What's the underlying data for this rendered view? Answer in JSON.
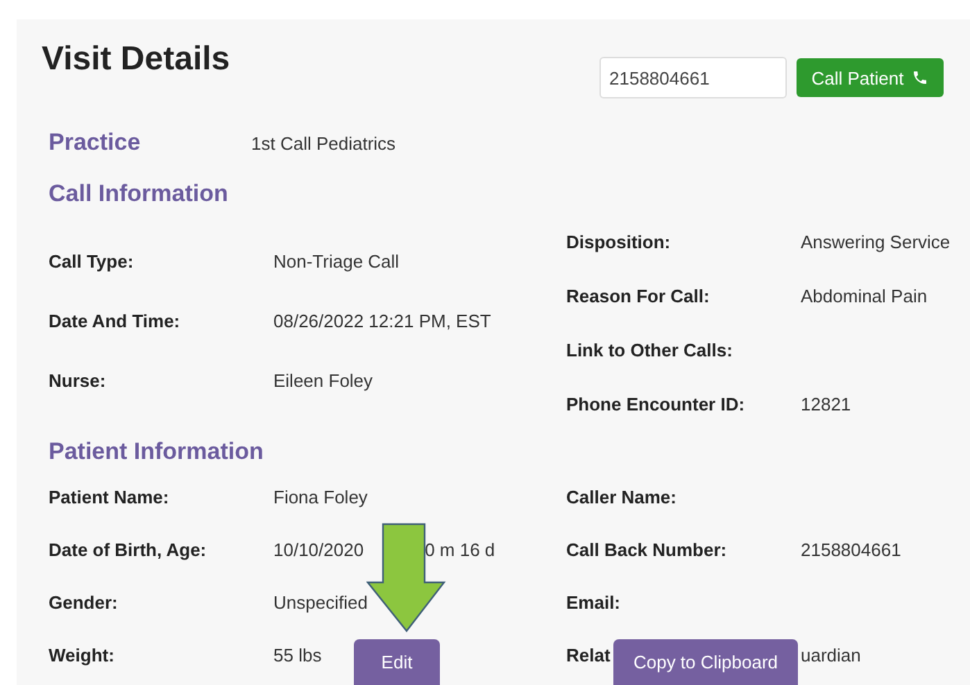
{
  "title": "Visit Details",
  "phone_field": {
    "value": "2158804661"
  },
  "call_button": {
    "label": "Call Patient"
  },
  "practice": {
    "label": "Practice",
    "value": "1st Call Pediatrics"
  },
  "call_information": {
    "heading": "Call Information",
    "left": [
      {
        "label": "Call Type:",
        "values": [
          "Non-Triage Call"
        ]
      },
      {
        "label": "Date And Time:",
        "values": [
          "08/26/2022 12:21 PM, EST"
        ]
      },
      {
        "label": "Nurse:",
        "values": [
          "Eileen Foley"
        ]
      }
    ],
    "right": [
      {
        "label": "Disposition:",
        "values": [
          "Answering Service"
        ]
      },
      {
        "label": "Reason For Call:",
        "values": [
          "Abdominal Pain"
        ]
      },
      {
        "label": "Link to Other Calls:"
      },
      {
        "label": "Phone Encounter ID:",
        "values": [
          "12821"
        ]
      }
    ]
  },
  "patient_information": {
    "heading": "Patient Information",
    "left": [
      {
        "label": "Patient Name:",
        "values": [
          "Fiona Foley"
        ]
      },
      {
        "label": "Date of Birth, Age:",
        "values": [
          "10/10/2020",
          "0 m 16 d"
        ]
      },
      {
        "label": "Gender:",
        "values": [
          "Unspecified"
        ]
      },
      {
        "label": "Weight:",
        "values": [
          "55 lbs"
        ]
      }
    ],
    "right": [
      {
        "label": "Caller Name:"
      },
      {
        "label": "Call Back Number:",
        "values": [
          "2158804661"
        ]
      },
      {
        "label": "Email:"
      },
      {
        "label": "Relat",
        "values": [
          "uardian"
        ]
      }
    ]
  },
  "edit_button": {
    "label": "Edit"
  },
  "copy_button": {
    "label": "Copy to Clipboard"
  }
}
